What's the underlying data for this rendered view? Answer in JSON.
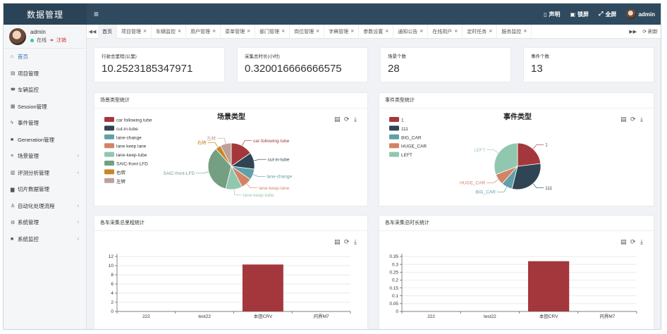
{
  "header": {
    "brand": "数据管理",
    "menu_toggle_icon": "menu-icon",
    "statement": "声明",
    "lock": "锁屏",
    "fullscreen": "全屏",
    "user": "admin"
  },
  "sidebar": {
    "user": {
      "name": "admin",
      "online": "在线",
      "logout": "注销"
    },
    "items": [
      {
        "label": "首页",
        "icon": "home-icon",
        "glyph": "⌂",
        "active": true,
        "has_children": false
      },
      {
        "label": "项目管理",
        "icon": "project-icon",
        "glyph": "▤",
        "active": false,
        "has_children": false
      },
      {
        "label": "车辆监控",
        "icon": "car-icon",
        "glyph": "◚",
        "active": false,
        "has_children": false
      },
      {
        "label": "Session管理",
        "icon": "database-icon",
        "glyph": "▦",
        "active": false,
        "has_children": false
      },
      {
        "label": "事件管理",
        "icon": "bolt-icon",
        "glyph": "ϟ",
        "active": false,
        "has_children": false
      },
      {
        "label": "Generation管理",
        "icon": "folder-icon",
        "glyph": "■",
        "active": false,
        "has_children": false
      },
      {
        "label": "场景管理",
        "icon": "list-icon",
        "glyph": "≡",
        "active": false,
        "has_children": true
      },
      {
        "label": "评测分析管理",
        "icon": "chart-icon",
        "glyph": "▥",
        "active": false,
        "has_children": true
      },
      {
        "label": "切片数据管理",
        "icon": "bar-chart-icon",
        "glyph": "▆",
        "active": false,
        "has_children": false
      },
      {
        "label": "自动化处理流程",
        "icon": "anchor-icon",
        "glyph": "⚓",
        "active": false,
        "has_children": true
      },
      {
        "label": "系统管理",
        "icon": "gear-icon",
        "glyph": "⚙",
        "active": false,
        "has_children": true
      },
      {
        "label": "系统监控",
        "icon": "video-icon",
        "glyph": "■",
        "active": false,
        "has_children": true
      }
    ]
  },
  "tabs": {
    "items": [
      {
        "label": "首页",
        "active": true,
        "closable": false
      },
      {
        "label": "项目管理",
        "active": false,
        "closable": true
      },
      {
        "label": "车辆监控",
        "active": false,
        "closable": true
      },
      {
        "label": "用户管理",
        "active": false,
        "closable": true
      },
      {
        "label": "菜单管理",
        "active": false,
        "closable": true
      },
      {
        "label": "部门管理",
        "active": false,
        "closable": true
      },
      {
        "label": "岗位管理",
        "active": false,
        "closable": true
      },
      {
        "label": "字典管理",
        "active": false,
        "closable": true
      },
      {
        "label": "参数设置",
        "active": false,
        "closable": true
      },
      {
        "label": "通知公告",
        "active": false,
        "closable": true
      },
      {
        "label": "在线用户",
        "active": false,
        "closable": true
      },
      {
        "label": "定时任务",
        "active": false,
        "closable": true
      },
      {
        "label": "服务监控",
        "active": false,
        "closable": true
      }
    ],
    "refresh": "刷新"
  },
  "stats": [
    {
      "label": "行驶总里程(公里)",
      "value": "10.2523185347971"
    },
    {
      "label": "采集总时长(小时)",
      "value": "0.320016666666575"
    },
    {
      "label": "场景个数",
      "value": "28"
    },
    {
      "label": "事件个数",
      "value": "13"
    }
  ],
  "panels": {
    "scene_title": "场景类型统计",
    "event_title": "事件类型统计",
    "mileage_title": "各车采集总里程统计",
    "duration_title": "各车采集总时长统计"
  },
  "chart_data": [
    {
      "type": "pie",
      "title": "场景类型",
      "labels": [
        "car-following-tube",
        "cut-in-tube",
        "lane-change",
        "lane-keep-lane",
        "lane-keep-tube",
        "SAIC-front-LFD",
        "右转",
        "左转"
      ],
      "legend_labels": [
        "car following tube",
        "cut-in-tube",
        "lane-change",
        "lane keep lane",
        "lane-keep-tube",
        "SAIC-front-LFD",
        "右转",
        "左转"
      ],
      "values": [
        4,
        3,
        2,
        2,
        3,
        9,
        1,
        2
      ],
      "colors": [
        "#a4373c",
        "#2f4554",
        "#61a0a8",
        "#d48265",
        "#91c7ae",
        "#749f83",
        "#ca8622",
        "#bda29a"
      ],
      "legend": "left"
    },
    {
      "type": "pie",
      "title": "事件类型",
      "labels": [
        "1",
        "111",
        "BIG_CAR",
        "HUGE_CAR",
        "LEFT"
      ],
      "legend_labels": [
        "1",
        "111",
        "BIG_CAR",
        "HUGE_CAR",
        "LEFT"
      ],
      "values": [
        3,
        4,
        1,
        1,
        4
      ],
      "colors": [
        "#a4373c",
        "#2f4554",
        "#61a0a8",
        "#d48265",
        "#91c7ae"
      ],
      "legend": "left"
    },
    {
      "type": "bar",
      "categories": [
        "222",
        "test22",
        "本田CRV",
        "问界M7"
      ],
      "values": [
        0,
        0,
        10.25,
        0
      ],
      "ylim": [
        0,
        12
      ],
      "yticks": [
        0,
        2,
        4,
        6,
        8,
        10,
        12
      ],
      "color": "#a4373c"
    },
    {
      "type": "bar",
      "categories": [
        "222",
        "test22",
        "本田CRV",
        "问界M7"
      ],
      "values": [
        0,
        0,
        0.32,
        0
      ],
      "ylim": [
        0,
        0.35
      ],
      "yticks": [
        0,
        0.05,
        0.1,
        0.15,
        0.2,
        0.25,
        0.3,
        0.35
      ],
      "color": "#a4373c"
    }
  ]
}
